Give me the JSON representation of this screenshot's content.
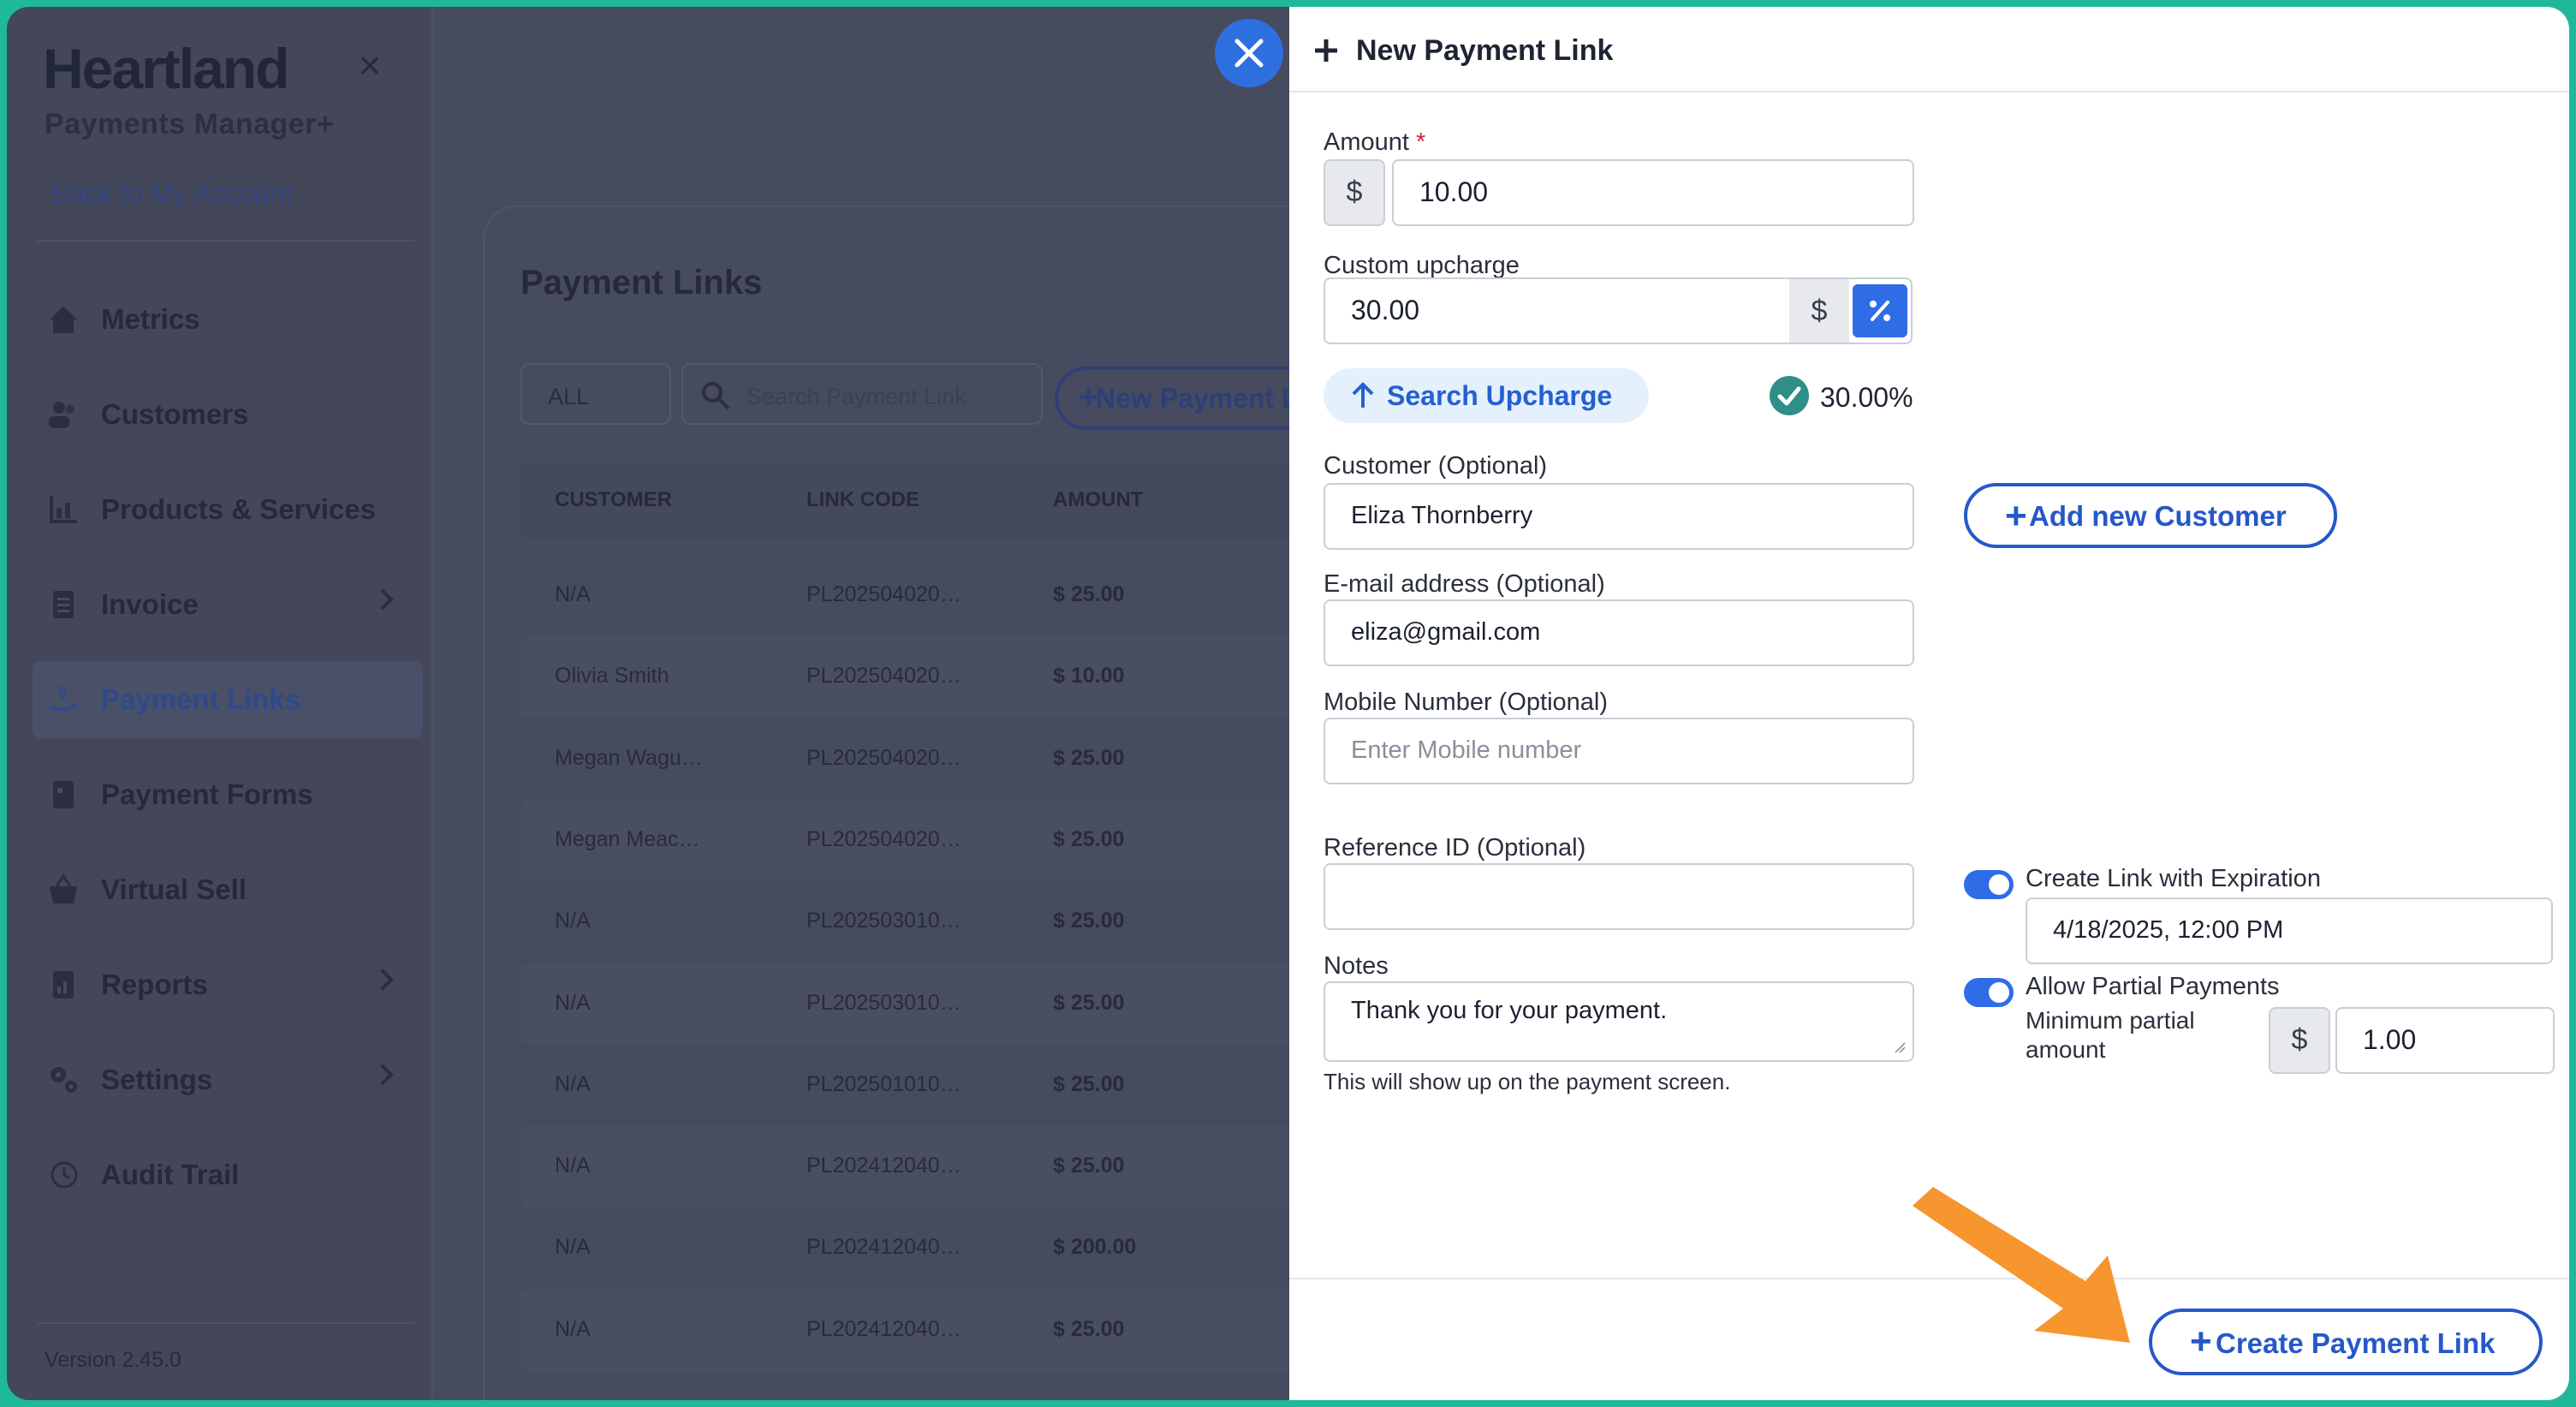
{
  "sidebar": {
    "brand": "Heartland",
    "brand_sub": "Payments Manager+",
    "back_link": "Back to My Account",
    "items": [
      {
        "label": "Metrics",
        "icon": "home-icon",
        "chevron": false
      },
      {
        "label": "Customers",
        "icon": "users-icon",
        "chevron": false
      },
      {
        "label": "Products & Services",
        "icon": "chart-icon",
        "chevron": false
      },
      {
        "label": "Invoice",
        "icon": "document-icon",
        "chevron": true
      },
      {
        "label": "Payment Links",
        "icon": "hand-dollar-icon",
        "chevron": false,
        "active": true
      },
      {
        "label": "Payment Forms",
        "icon": "form-icon",
        "chevron": false
      },
      {
        "label": "Virtual Sell",
        "icon": "basket-icon",
        "chevron": false
      },
      {
        "label": "Reports",
        "icon": "report-icon",
        "chevron": true
      },
      {
        "label": "Settings",
        "icon": "gear-icon",
        "chevron": true
      },
      {
        "label": "Audit Trail",
        "icon": "history-icon",
        "chevron": false
      }
    ],
    "version": "Version 2.45.0"
  },
  "page": {
    "title": "Payment Links",
    "filter": "ALL",
    "search_placeholder": "Search Payment Link",
    "new_button": "New Payment Link",
    "columns": [
      "CUSTOMER",
      "LINK CODE",
      "AMOUNT"
    ],
    "rows": [
      {
        "customer": "N/A",
        "code": "PL202504020…",
        "amount": "$ 25.00"
      },
      {
        "customer": "Olivia Smith",
        "code": "PL202504020…",
        "amount": "$ 10.00"
      },
      {
        "customer": "Megan Wagu…",
        "code": "PL202504020…",
        "amount": "$ 25.00"
      },
      {
        "customer": "Megan Meac…",
        "code": "PL202504020…",
        "amount": "$ 25.00"
      },
      {
        "customer": "N/A",
        "code": "PL202503010…",
        "amount": "$ 25.00"
      },
      {
        "customer": "N/A",
        "code": "PL202503010…",
        "amount": "$ 25.00"
      },
      {
        "customer": "N/A",
        "code": "PL202501010…",
        "amount": "$ 25.00"
      },
      {
        "customer": "N/A",
        "code": "PL202412040…",
        "amount": "$ 25.00"
      },
      {
        "customer": "N/A",
        "code": "PL202412040…",
        "amount": "$ 200.00"
      },
      {
        "customer": "N/A",
        "code": "PL202412040…",
        "amount": "$ 25.00"
      }
    ]
  },
  "modal": {
    "title": "New Payment Link",
    "amount": {
      "label": "Amount",
      "required_mark": "*",
      "currency": "$",
      "value": "10.00"
    },
    "upcharge": {
      "label": "Custom upcharge",
      "value": "30.00",
      "dollar": "$",
      "mode": "percent"
    },
    "search_upcharge": "Search Upcharge",
    "upcharge_result": "30.00%",
    "customer": {
      "label": "Customer (Optional)",
      "value": "Eliza Thornberry"
    },
    "add_customer": "Add new Customer",
    "email": {
      "label": "E-mail address (Optional)",
      "value": "eliza@gmail.com"
    },
    "mobile": {
      "label": "Mobile Number (Optional)",
      "placeholder": "Enter Mobile number"
    },
    "reference": {
      "label": "Reference ID (Optional)",
      "value": ""
    },
    "notes": {
      "label": "Notes",
      "value": "Thank you for your payment.",
      "help": "This will show up on the payment screen."
    },
    "expiration": {
      "label": "Create Link with Expiration",
      "enabled": true,
      "value": "4/18/2025, 12:00 PM"
    },
    "partial": {
      "label": "Allow Partial Payments",
      "enabled": true,
      "min_label_1": "Minimum partial",
      "min_label_2": "amount",
      "currency": "$",
      "value": "1.00"
    },
    "create_button": "Create Payment Link"
  },
  "colors": {
    "accent": "#2f6de6",
    "frame": "#1fb99a",
    "arrow": "#f7952f"
  }
}
